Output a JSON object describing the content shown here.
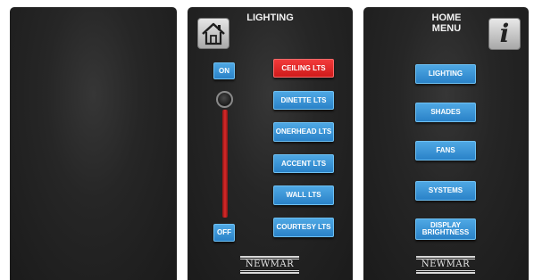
{
  "lighting": {
    "title": "LIGHTING",
    "on_label": "ON",
    "off_label": "OFF",
    "dimmer_level": 1.0,
    "buttons": [
      "CEILING LTS",
      "DINETTE LTS",
      "ONERHEAD LTS",
      "ACCENT LTS",
      "WALL LTS",
      "COURTESY LTS"
    ],
    "active_button": "CEILING LTS",
    "logo": "NEWMAR"
  },
  "home_menu": {
    "title_line1": "HOME",
    "title_line2": "MENU",
    "info_label": "i",
    "buttons": [
      "LIGHTING",
      "SHADES",
      "FANS",
      "SYSTEMS"
    ],
    "display_line1": "DISPLAY",
    "display_line2": "BRIGHTNESS",
    "logo": "NEWMAR"
  },
  "colors": {
    "button_blue": "#3a93d6",
    "button_active_red": "#e02a2a",
    "panel_bg": "#1f1f1f"
  },
  "icons": [
    "home-icon",
    "info-icon",
    "slider-knob"
  ]
}
